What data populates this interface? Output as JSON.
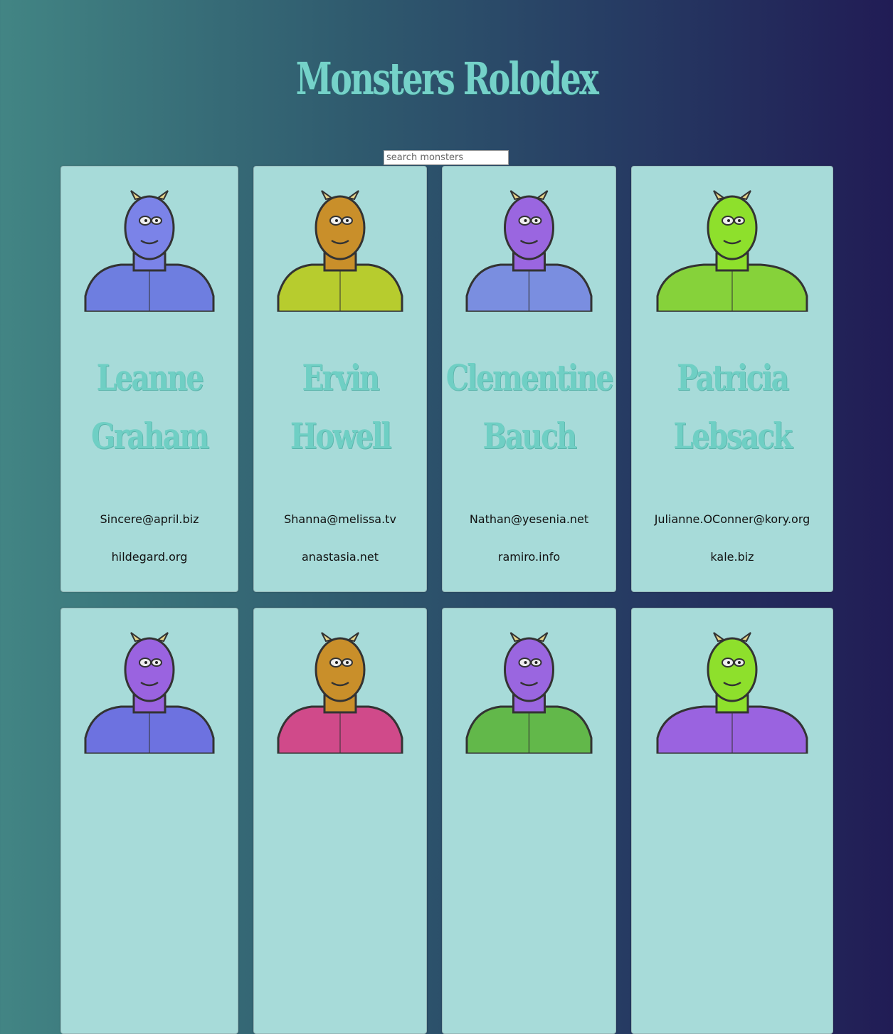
{
  "app": {
    "title": "Monsters Rolodex"
  },
  "search": {
    "placeholder": "search monsters",
    "value": ""
  },
  "monsters": [
    {
      "name": "Leanne Graham",
      "email": "Sincere@april.biz",
      "website": "hildegard.org",
      "skin": "#7b83e8",
      "suit": "#6e7ee0",
      "icon": "horned-monster-icon"
    },
    {
      "name": "Ervin Howell",
      "email": "Shanna@melissa.tv",
      "website": "anastasia.net",
      "skin": "#c98f2a",
      "suit": "#b7cc2e",
      "icon": "spiky-monster-icon"
    },
    {
      "name": "Clementine Bauch",
      "email": "Nathan@yesenia.net",
      "website": "ramiro.info",
      "skin": "#9a66e0",
      "suit": "#7a8ee0",
      "icon": "cyclops-robot-monster-icon"
    },
    {
      "name": "Patricia Lebsack",
      "email": "Julianne.OConner@kory.org",
      "website": "kale.biz",
      "skin": "#8ee02c",
      "suit": "#86d23a",
      "icon": "helmet-monster-icon"
    },
    {
      "name": "",
      "email": "",
      "website": "",
      "skin": "#9a63e0",
      "suit": "#6d72e0",
      "icon": "armored-monster-icon"
    },
    {
      "name": "",
      "email": "",
      "website": "",
      "skin": "#c98f2a",
      "suit": "#d04a8a",
      "icon": "antenna-monster-icon"
    },
    {
      "name": "",
      "email": "",
      "website": "",
      "skin": "#9a66e0",
      "suit": "#62b84a",
      "icon": "horn-cyclops-monster-icon"
    },
    {
      "name": "",
      "email": "",
      "website": "",
      "skin": "#8ee02c",
      "suit": "#9a63e0",
      "icon": "goggles-monster-icon"
    }
  ]
}
